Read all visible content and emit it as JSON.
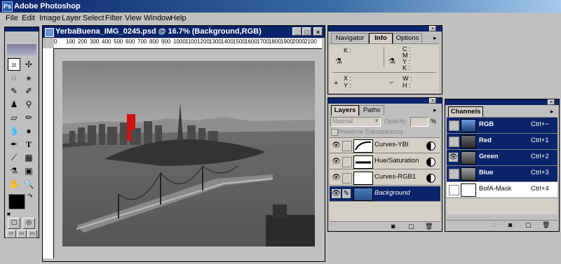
{
  "app": {
    "title": "Adobe Photoshop"
  },
  "menu": [
    "File",
    "Edit",
    "Image",
    "Layer",
    "Select",
    "Filter",
    "View",
    "Window",
    "Help"
  ],
  "document": {
    "title": "YerbaBuena_IMG_0245.psd @ 16.7% (Background,RGB)",
    "ruler_ticks": [
      "0",
      "100",
      "200",
      "300",
      "400",
      "500",
      "600",
      "700",
      "800",
      "900",
      "1000",
      "1100",
      "1200",
      "1300",
      "1400",
      "1500",
      "1600",
      "1700",
      "1800",
      "1900",
      "2000",
      "2100"
    ]
  },
  "info_panel": {
    "tabs": [
      "Navigator",
      "Info",
      "Options"
    ],
    "active_tab": "Info",
    "fields": {
      "k": "K :",
      "c": "C :",
      "m": "M :",
      "y": "Y :",
      "k2": "K :",
      "x": "X :",
      "y2": "Y :",
      "w": "W :",
      "h": "H :"
    }
  },
  "layers_panel": {
    "tabs": [
      "Layers",
      "Paths"
    ],
    "active_tab": "Layers",
    "blend_mode": "Normal",
    "opacity_label": "Opacity:",
    "opacity_unit": "%",
    "preserve_transparency": "Preserve Transparency",
    "layers": [
      {
        "name": "Curves-YBI"
      },
      {
        "name": "Hue/Saturation"
      },
      {
        "name": "Curves-RGB1"
      },
      {
        "name": "Background"
      }
    ]
  },
  "channels_panel": {
    "tabs": [
      "Channels"
    ],
    "channels": [
      {
        "name": "RGB",
        "shortcut": "Ctrl+~"
      },
      {
        "name": "Red",
        "shortcut": "Ctrl+1"
      },
      {
        "name": "Green",
        "shortcut": "Ctrl+2"
      },
      {
        "name": "Blue",
        "shortcut": "Ctrl+3"
      },
      {
        "name": "BofA-Mask",
        "shortcut": "Ctrl+4"
      }
    ]
  },
  "colors": {
    "title_blue": "#0a246a",
    "selection": "#0a246a",
    "highlight_red": "#d41010"
  },
  "icons": {
    "toolbox": [
      "marquee-icon",
      "move-icon",
      "lasso-icon",
      "magic-wand-icon",
      "crop-icon",
      "slice-icon",
      "airbrush-icon",
      "brush-icon",
      "stamp-icon",
      "history-brush-icon",
      "eraser-icon",
      "pencil-icon",
      "blur-icon",
      "dodge-icon",
      "pen-icon",
      "type-icon",
      "measure-icon",
      "gradient-icon",
      "eyedropper-icon",
      "paint-bucket-icon",
      "hand-icon",
      "zoom-icon"
    ]
  }
}
